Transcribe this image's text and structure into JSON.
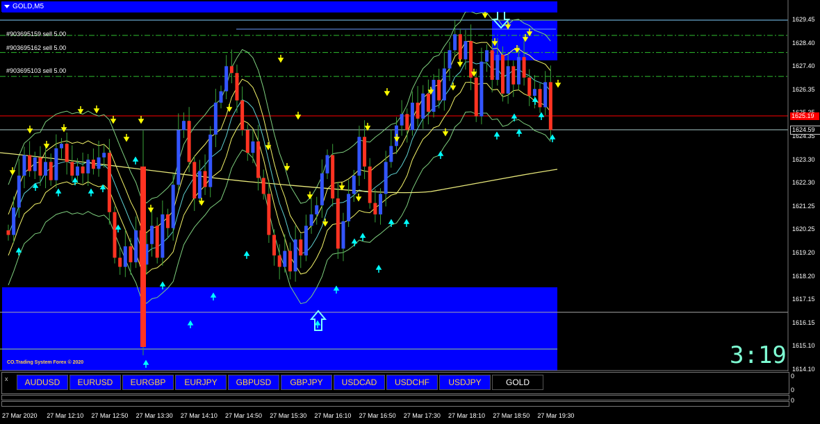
{
  "window_title": "GOLD,M5",
  "orders": [
    {
      "label": "#903695159 sell 5.00",
      "price": 1628.75
    },
    {
      "label": "#903695162 sell 5.00",
      "price": 1628.0
    },
    {
      "label": "#903695103 sell 5.00",
      "price": 1626.95
    }
  ],
  "price_axis": [
    "1629.45",
    "1628.40",
    "1627.40",
    "1626.35",
    "1625.35",
    "1624.35",
    "1623.30",
    "1622.30",
    "1621.25",
    "1620.25",
    "1619.20",
    "1618.20",
    "1617.15",
    "1616.15",
    "1615.10",
    "1614.10"
  ],
  "bid_price": "1625.19",
  "last_price": "1624.59",
  "timer": "3:19",
  "watermark": "CO.Trading System Forex © 2020",
  "symbols": [
    {
      "label": "AUDUSD",
      "active": false
    },
    {
      "label": "EURUSD",
      "active": false
    },
    {
      "label": "EURGBP",
      "active": false
    },
    {
      "label": "EURJPY",
      "active": false
    },
    {
      "label": "GBPUSD",
      "active": false
    },
    {
      "label": "GBPJPY",
      "active": false
    },
    {
      "label": "USDCAD",
      "active": false
    },
    {
      "label": "USDCHF",
      "active": false
    },
    {
      "label": "USDJPY",
      "active": false
    },
    {
      "label": "GOLD",
      "active": true
    }
  ],
  "subwindow_scale": [
    "0",
    "0",
    "0"
  ],
  "subwindow_close": "x",
  "time_axis": [
    "27 Mar 2020",
    "27 Mar 12:10",
    "27 Mar 12:50",
    "27 Mar 13:30",
    "27 Mar 14:10",
    "27 Mar 14:50",
    "27 Mar 15:30",
    "27 Mar 16:10",
    "27 Mar 16:50",
    "27 Mar 17:30",
    "27 Mar 18:10",
    "27 Mar 18:50",
    "27 Mar 19:30"
  ],
  "colors": {
    "bull": "#3355ff",
    "bear": "#ff3322",
    "arrow_up": "#00ffff",
    "arrow_down": "#ffff00",
    "zone": "#0000ff",
    "bid_line": "#ff0000"
  }
}
